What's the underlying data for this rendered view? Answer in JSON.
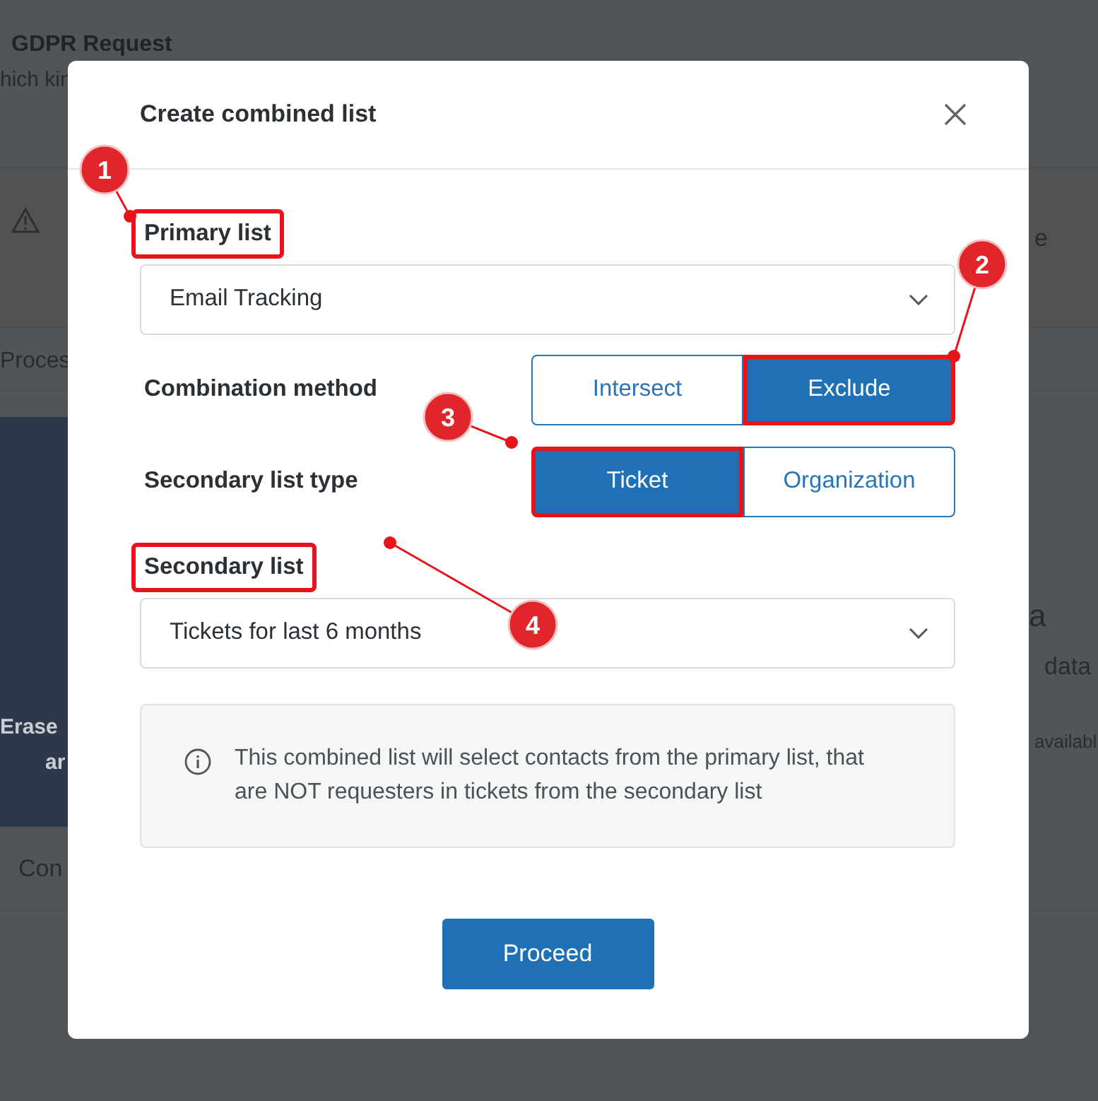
{
  "background": {
    "fragments": [
      {
        "kind": "heading",
        "text": "GDPR Request"
      },
      {
        "kind": "text",
        "text": "hich kin"
      },
      {
        "kind": "text",
        "text": "e"
      },
      {
        "kind": "text",
        "text": "Proces"
      },
      {
        "kind": "light",
        "text": "Erase"
      },
      {
        "kind": "light",
        "text": "ar"
      },
      {
        "kind": "text",
        "text": "a"
      },
      {
        "kind": "text",
        "text": "data"
      },
      {
        "kind": "text",
        "text": "availabl"
      },
      {
        "kind": "text",
        "text": "Con"
      }
    ]
  },
  "modal": {
    "title": "Create combined list",
    "primary_list": {
      "label": "Primary list",
      "highlighted": true,
      "value": "Email Tracking"
    },
    "combination_method": {
      "label": "Combination method",
      "options": [
        {
          "label": "Intersect",
          "selected": false,
          "highlighted": false
        },
        {
          "label": "Exclude",
          "selected": true,
          "highlighted": true
        }
      ]
    },
    "secondary_list_type": {
      "label": "Secondary list type",
      "options": [
        {
          "label": "Ticket",
          "selected": true,
          "highlighted": true
        },
        {
          "label": "Organization",
          "selected": false,
          "highlighted": false
        }
      ]
    },
    "secondary_list": {
      "label": "Secondary list",
      "highlighted": true,
      "value": "Tickets for last 6 months"
    },
    "info": "This combined list will select contacts from the primary list, that are NOT requesters in tickets from the secondary list",
    "buttons": [
      {
        "label": "Proceed"
      }
    ]
  },
  "annotations": [
    {
      "label": "1"
    },
    {
      "label": "2"
    },
    {
      "label": "3"
    },
    {
      "label": "4"
    }
  ]
}
